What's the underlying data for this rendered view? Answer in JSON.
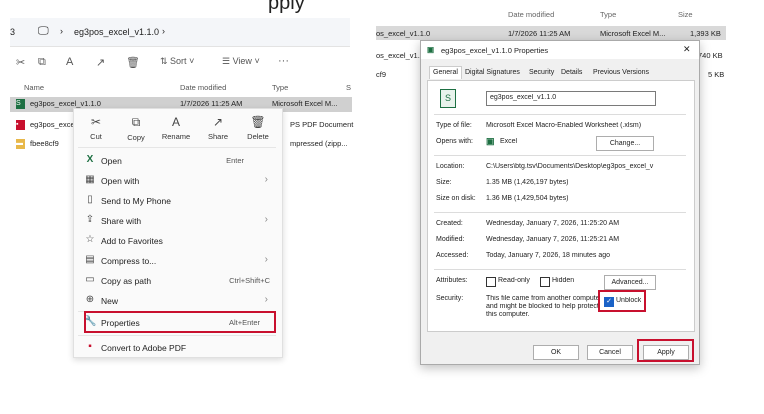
{
  "cut_title": "pply",
  "explorer": {
    "breadcrumb_prefix": "3",
    "breadcrumb_folder": "eg3pos_excel_v1.1.0",
    "toolbar": {
      "sort_label": "Sort",
      "view_label": "View",
      "more_label": "···"
    },
    "columns": {
      "name": "Name",
      "date": "Date modified",
      "type": "Type",
      "size": "S"
    },
    "files": [
      {
        "name": "eg3pos_excel_v1.1.0",
        "date": "1/7/2026 11:25 AM",
        "type": "Microsoft Excel M...",
        "icon_color": "#1d6f42",
        "icon": "S"
      },
      {
        "name": "eg3pos_exce",
        "type": "PS PDF Document",
        "icon_color": "#c8102e",
        "icon": "▪"
      },
      {
        "name": "fbee8cf9",
        "type": "mpressed (zipp...",
        "icon_color": "#e8b84a",
        "icon": "▬"
      }
    ],
    "quick_actions": [
      {
        "label": "Cut",
        "icon": "✂"
      },
      {
        "label": "Copy",
        "icon": "⧉"
      },
      {
        "label": "Rename",
        "icon": "A"
      },
      {
        "label": "Share",
        "icon": "↗"
      },
      {
        "label": "Delete",
        "icon": "🗑"
      }
    ],
    "menu": [
      {
        "label": "Open",
        "shortcut": "Enter",
        "icon": "X",
        "icon_color": "#1d6f42"
      },
      {
        "label": "Open with",
        "arrow": "›",
        "icon": "▦"
      },
      {
        "label": "Send to My Phone",
        "icon": "▯"
      },
      {
        "label": "Share with",
        "arrow": "›",
        "icon": "⇪"
      },
      {
        "label": "Add to Favorites",
        "icon": "☆"
      },
      {
        "label": "Compress to...",
        "arrow": "›",
        "icon": "▤"
      },
      {
        "label": "Copy as path",
        "shortcut": "Ctrl+Shift+C",
        "icon": "▭"
      },
      {
        "label": "New",
        "arrow": "›",
        "icon": "⊕"
      },
      {
        "label": "Properties",
        "shortcut": "Alt+Enter",
        "icon": "🔧"
      },
      {
        "label": "Convert to Adobe PDF",
        "icon": "▪",
        "icon_color": "#c8102e"
      }
    ]
  },
  "behind": {
    "headers": {
      "date": "Date modified",
      "type": "Type",
      "size": "Size"
    },
    "rows": [
      {
        "name": "os_excel_v1.1.0",
        "date": "1/7/2026 11:25 AM",
        "type": "Microsoft Excel M...",
        "size": "1,393 KB"
      },
      {
        "name": "os_excel_v1.1.0",
        "size": "740 KB"
      },
      {
        "name": "cf9",
        "size": "5 KB"
      }
    ]
  },
  "dialog": {
    "title": "eg3pos_excel_v1.1.0 Properties",
    "close": "✕",
    "tabs": [
      "General",
      "Digital Signatures",
      "Security",
      "Details",
      "Previous Versions"
    ],
    "filename": "eg3pos_excel_v1.1.0",
    "type_label": "Type of file:",
    "type_value": "Microsoft Excel Macro-Enabled Worksheet (.xlsm)",
    "opens_label": "Opens with:",
    "opens_value": "Excel",
    "change_button": "Change...",
    "location_label": "Location:",
    "location_value": "C:\\Users\\btg.tsv\\Documents\\Desktop\\eg3pos_excel_v",
    "size_label": "Size:",
    "size_value": "1.35 MB (1,426,197 bytes)",
    "size_disk_label": "Size on disk:",
    "size_disk_value": "1.36 MB (1,429,504 bytes)",
    "created_label": "Created:",
    "created_value": "Wednesday, January 7, 2026, 11:25:20 AM",
    "modified_label": "Modified:",
    "modified_value": "Wednesday, January 7, 2026, 11:25:21 AM",
    "accessed_label": "Accessed:",
    "accessed_value": "Today, January 7, 2026, 18 minutes ago",
    "attributes_label": "Attributes:",
    "readonly_label": "Read-only",
    "hidden_label": "Hidden",
    "advanced_button": "Advanced...",
    "security_label": "Security:",
    "security_line1": "This file came from another compute",
    "security_line2": "and might be blocked to help protect",
    "security_line3": "this computer.",
    "unblock_label": "Unblock",
    "ok_button": "OK",
    "cancel_button": "Cancel",
    "apply_button": "Apply",
    "accent": "#c8102e"
  }
}
